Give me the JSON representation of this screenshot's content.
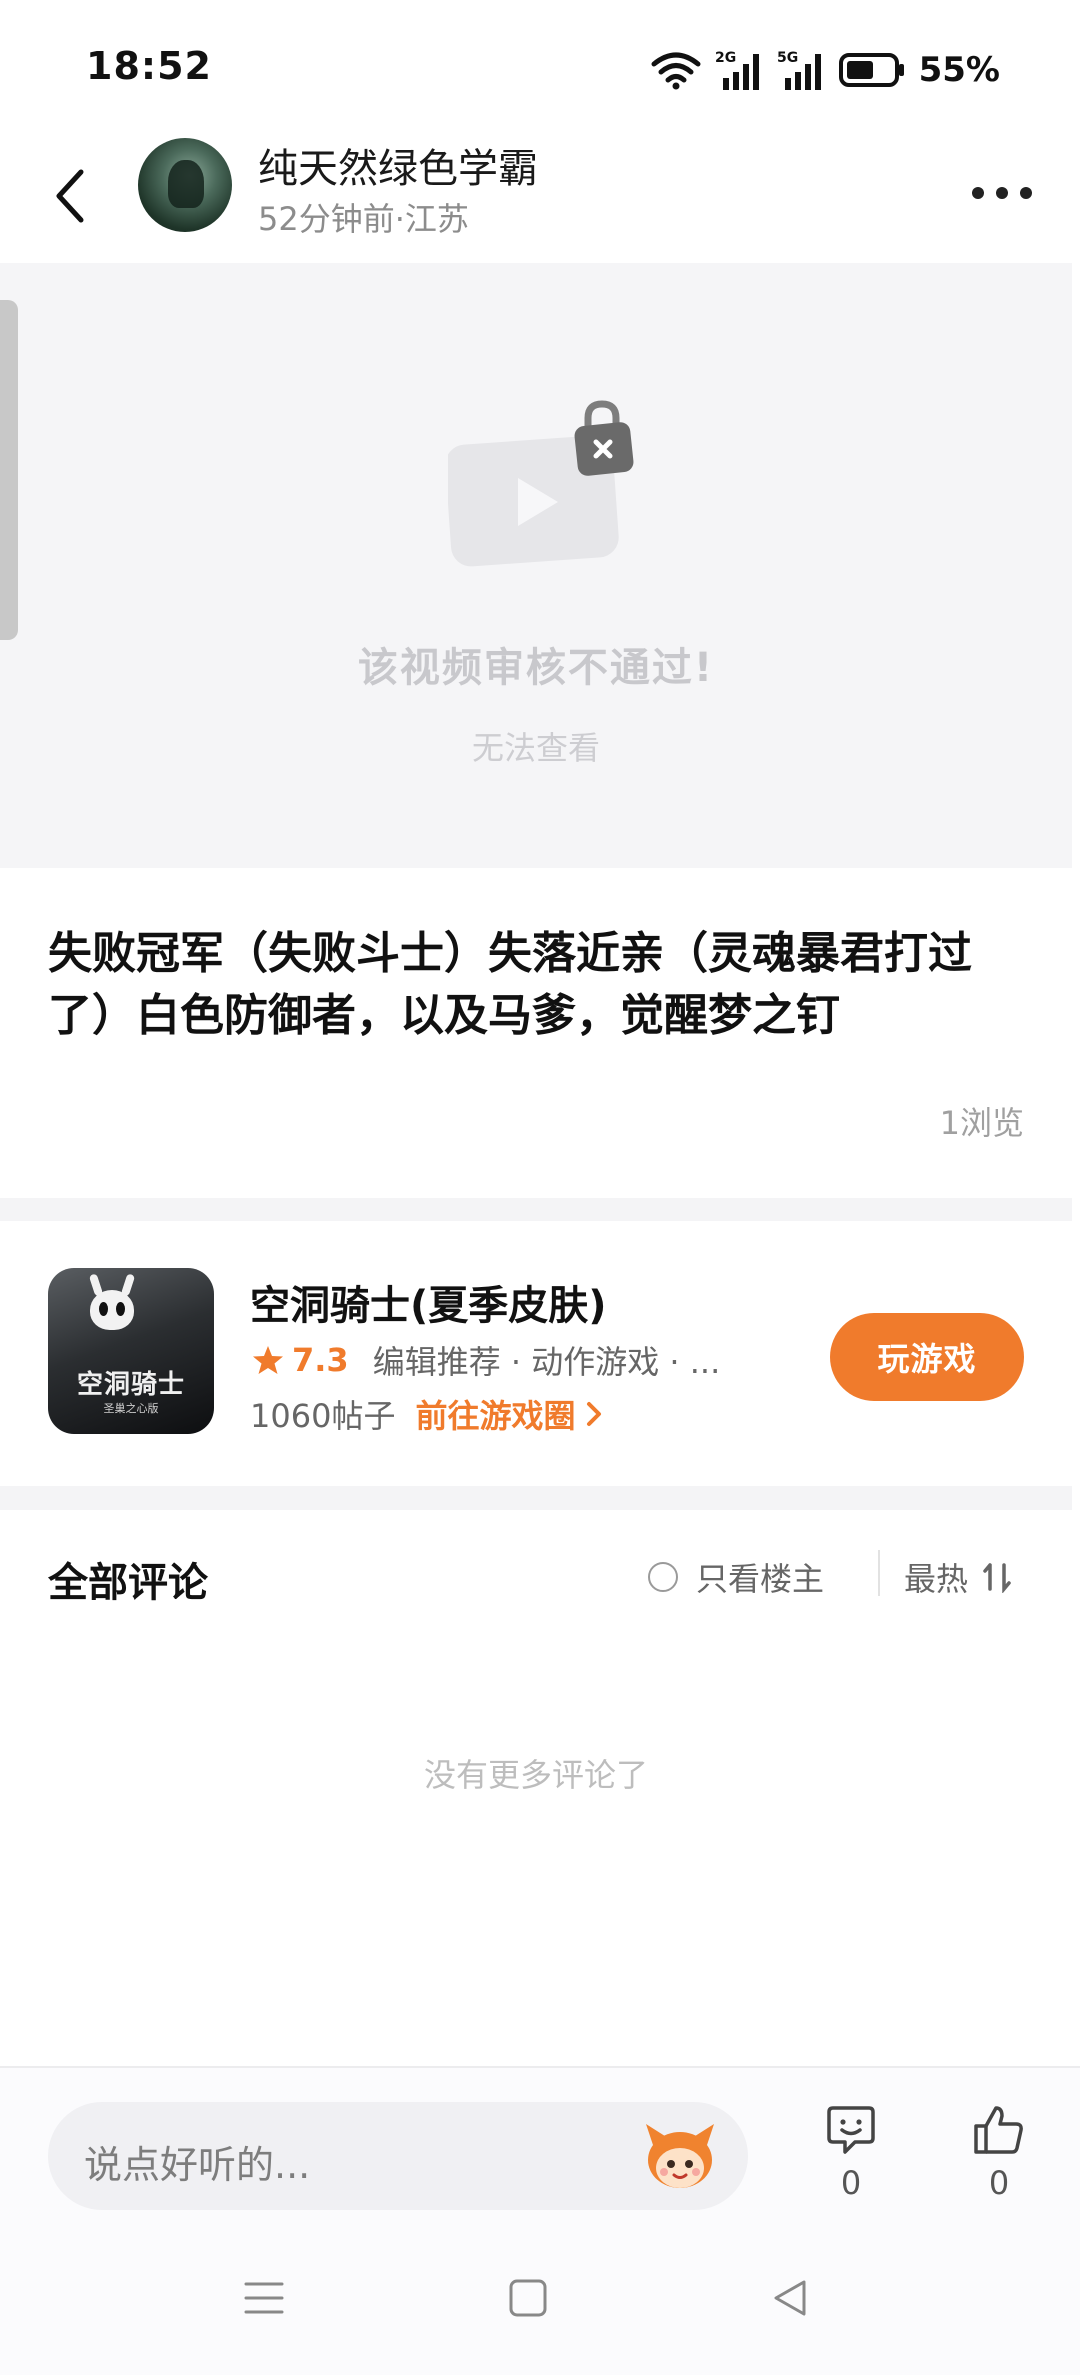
{
  "status_bar": {
    "time": "18:52",
    "battery": "55%",
    "signals": [
      "wifi-icon",
      "2g-signal-icon",
      "5g-signal-icon",
      "battery-icon"
    ]
  },
  "header": {
    "user_name": "纯天然绿色学霸",
    "post_meta": "52分钟前·江苏"
  },
  "video": {
    "blocked_title": "该视频审核不通过!",
    "blocked_sub": "无法查看"
  },
  "post": {
    "title": "失败冠军（失败斗士）失落近亲（灵魂暴君打过了）白色防御者，以及马爹，觉醒梦之钉",
    "views": "1浏览"
  },
  "game": {
    "name": "空洞骑士(夏季皮肤)",
    "rating": "7.3",
    "tags": "编辑推荐 · 动作游戏 · ...",
    "post_count": "1060帖子",
    "goto_label": "前往游戏圈",
    "play_label": "玩游戏",
    "cover_title": "空洞骑士",
    "cover_subtitle": "圣巢之心版"
  },
  "comments": {
    "title": "全部评论",
    "only_op_label": "只看楼主",
    "sort_label": "最热",
    "empty_text": "没有更多评论了"
  },
  "bottom_bar": {
    "input_placeholder": "说点好听的...",
    "comment_count": "0",
    "like_count": "0"
  },
  "colors": {
    "accent": "#f07b2c",
    "muted_text": "#8c8c8c",
    "background_gray": "#f5f5f7"
  }
}
